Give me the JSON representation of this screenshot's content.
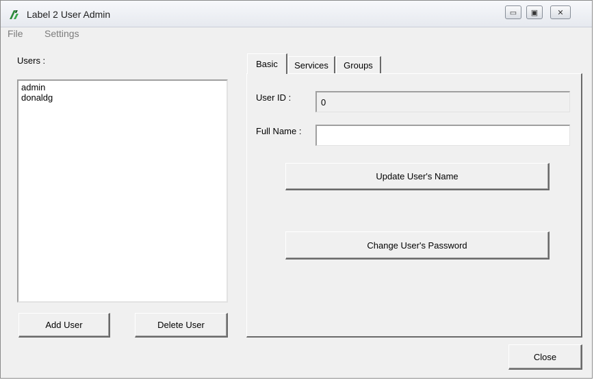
{
  "window": {
    "title": "Label 2 User Admin",
    "minimize_glyph": "▭",
    "maximize_glyph": "▣",
    "close_glyph": "✕"
  },
  "menu": {
    "items": [
      "File",
      "Settings"
    ]
  },
  "users_panel": {
    "label": "Users :",
    "users": [
      "admin",
      "donaldg"
    ],
    "add_button": "Add User",
    "delete_button": "Delete User"
  },
  "tabs": {
    "items": [
      "Basic",
      "Services",
      "Groups"
    ],
    "active": "Basic"
  },
  "basic": {
    "user_id_label": "User ID :",
    "user_id_value": "0",
    "full_name_label": "Full Name :",
    "full_name_value": "",
    "update_name_button": "Update User's Name",
    "change_password_button": "Change User's Password"
  },
  "footer": {
    "close_button": "Close"
  }
}
